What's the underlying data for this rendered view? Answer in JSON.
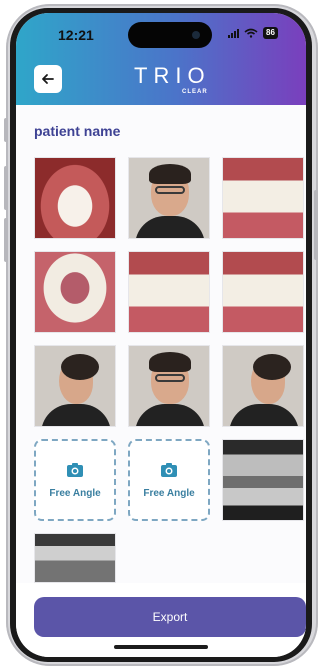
{
  "status_bar": {
    "time": "12:21",
    "battery": "86"
  },
  "header": {
    "back_icon": "arrow-left-icon",
    "logo_main": "TRIO",
    "logo_sub": "CLEAR"
  },
  "patient": {
    "name": "patient name"
  },
  "photos": [
    {
      "kind": "upper-occlusal"
    },
    {
      "kind": "frontal-smile-portrait"
    },
    {
      "kind": "right-buccal"
    },
    {
      "kind": "lower-occlusal"
    },
    {
      "kind": "frontal-intraoral"
    },
    {
      "kind": "left-buccal"
    },
    {
      "kind": "three-quarter-portrait"
    },
    {
      "kind": "frontal-portrait"
    },
    {
      "kind": "profile-portrait"
    }
  ],
  "upload_slots": [
    {
      "label": "Free Angle",
      "icon": "camera-icon"
    },
    {
      "label": "Free Angle",
      "icon": "camera-icon"
    }
  ],
  "xrays": [
    {
      "kind": "panoramic-xray"
    },
    {
      "kind": "cephalometric-xray"
    }
  ],
  "footer": {
    "export_label": "Export"
  },
  "colors": {
    "header_gradient_start": "#2fa6c9",
    "header_gradient_end": "#7a3fbd",
    "title_color": "#3e4294",
    "slot_accent": "#3a7fa0",
    "export_button": "#5b55a8"
  }
}
